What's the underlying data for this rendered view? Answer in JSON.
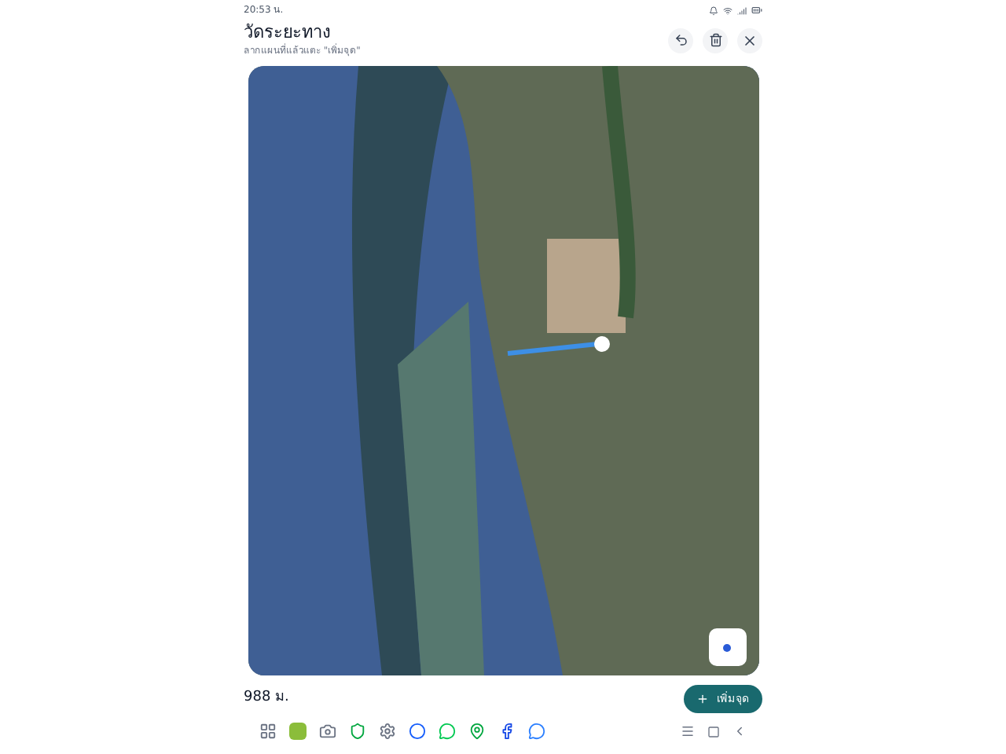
{
  "status_bar": {
    "time": "20:53 น."
  },
  "header": {
    "title": "วัดระยะทาง",
    "subtitle": "ลากแผนที่แล้วแตะ \"เพิ่มจุด\""
  },
  "footer": {
    "distance": "988 ม.",
    "add_button": "เพิ่มจุด"
  }
}
